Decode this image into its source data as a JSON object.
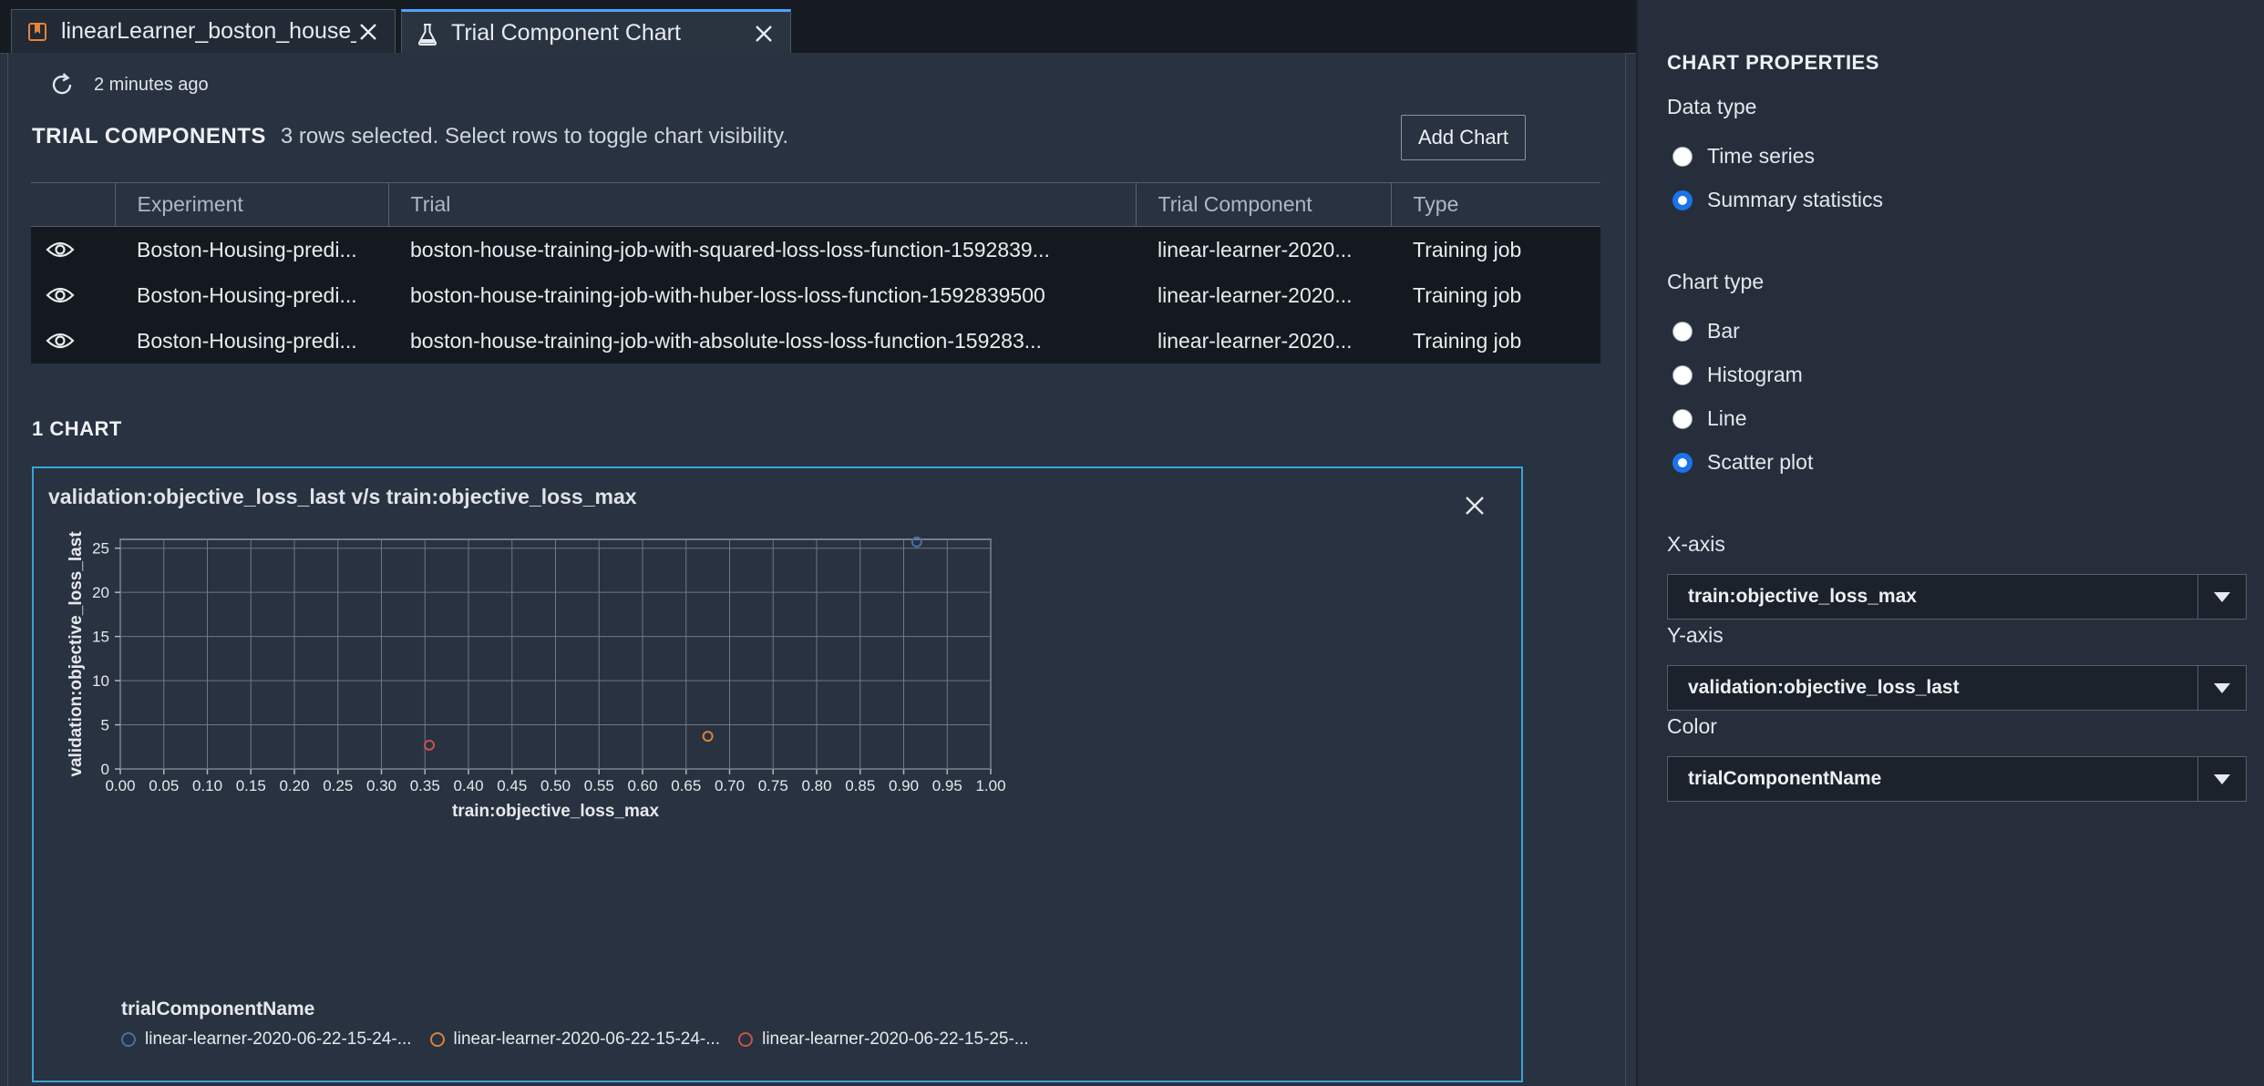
{
  "tabs": [
    {
      "label": "linearLearner_boston_house_",
      "icon": "bookmark-icon",
      "active": false
    },
    {
      "label": "Trial Component Chart",
      "icon": "flask-icon",
      "active": true
    }
  ],
  "refresh": {
    "text": "2 minutes ago"
  },
  "trial_components": {
    "title": "TRIAL COMPONENTS",
    "subtitle": "3 rows selected. Select rows to toggle chart visibility.",
    "add_chart_label": "Add Chart",
    "columns": [
      "Experiment",
      "Trial",
      "Trial Component",
      "Type"
    ],
    "rows": [
      {
        "experiment": "Boston-Housing-predi...",
        "trial": "boston-house-training-job-with-squared-loss-loss-function-1592839...",
        "component": "linear-learner-2020...",
        "type": "Training job"
      },
      {
        "experiment": "Boston-Housing-predi...",
        "trial": "boston-house-training-job-with-huber-loss-loss-function-1592839500",
        "component": "linear-learner-2020...",
        "type": "Training job"
      },
      {
        "experiment": "Boston-Housing-predi...",
        "trial": "boston-house-training-job-with-absolute-loss-loss-function-159283...",
        "component": "linear-learner-2020...",
        "type": "Training job"
      }
    ]
  },
  "charts_count": "1 CHART",
  "chart_data": {
    "type": "scatter",
    "title": "validation:objective_loss_last v/s train:objective_loss_max",
    "xlabel": "train:objective_loss_max",
    "ylabel": "validation:objective_loss_last",
    "xlim": [
      0,
      1
    ],
    "ylim": [
      0,
      26
    ],
    "x_ticks": [
      "0.00",
      "0.05",
      "0.10",
      "0.15",
      "0.20",
      "0.25",
      "0.30",
      "0.35",
      "0.40",
      "0.45",
      "0.50",
      "0.55",
      "0.60",
      "0.65",
      "0.70",
      "0.75",
      "0.80",
      "0.85",
      "0.90",
      "0.95",
      "1.00"
    ],
    "y_ticks": [
      "0",
      "5",
      "10",
      "15",
      "20",
      "25"
    ],
    "grid": true,
    "legend_title": "trialComponentName",
    "series": [
      {
        "name": "linear-learner-2020-06-22-15-24-...",
        "color": "#4a6fa5",
        "points": [
          {
            "x": 0.915,
            "y": 25.7
          }
        ]
      },
      {
        "name": "linear-learner-2020-06-22-15-24-...",
        "color": "#d9823a",
        "points": [
          {
            "x": 0.675,
            "y": 3.7
          }
        ]
      },
      {
        "name": "linear-learner-2020-06-22-15-25-...",
        "color": "#c9534a",
        "points": [
          {
            "x": 0.355,
            "y": 2.7
          }
        ]
      }
    ]
  },
  "chart_properties": {
    "title": "CHART PROPERTIES",
    "data_type_label": "Data type",
    "data_type_options": [
      "Time series",
      "Summary statistics"
    ],
    "data_type_selected": "Summary statistics",
    "chart_type_label": "Chart type",
    "chart_type_options": [
      "Bar",
      "Histogram",
      "Line",
      "Scatter plot"
    ],
    "chart_type_selected": "Scatter plot",
    "x_axis_label": "X-axis",
    "x_axis_value": "train:objective_loss_max",
    "y_axis_label": "Y-axis",
    "y_axis_value": "validation:objective_loss_last",
    "color_label": "Color",
    "color_value": "trialComponentName"
  }
}
